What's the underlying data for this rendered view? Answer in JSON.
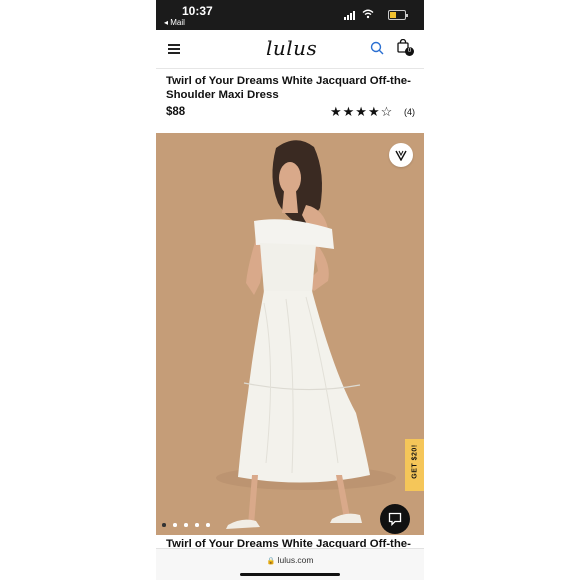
{
  "status": {
    "time": "10:37",
    "back_app": "◂ Mail"
  },
  "nav": {
    "logo": "lulus",
    "cart_count": "0"
  },
  "product": {
    "title": "Twirl of Your Dreams White Jacquard Off-the-Shoulder Maxi Dress",
    "title_repeat_visible": "Twirl of Your Dreams White Jacquard Off-the-",
    "price": "$88",
    "rating": 4,
    "rating_stars": "★★★★☆",
    "reviews": "(4)"
  },
  "gallery": {
    "image_count": 5,
    "active_index": 0,
    "promo_tab": "GET $20!"
  },
  "browser": {
    "url": "lulus.com"
  },
  "colors": {
    "accent_search": "#2a6fd1",
    "promo": "#f5c659",
    "hero_bg": "#c59d78"
  }
}
